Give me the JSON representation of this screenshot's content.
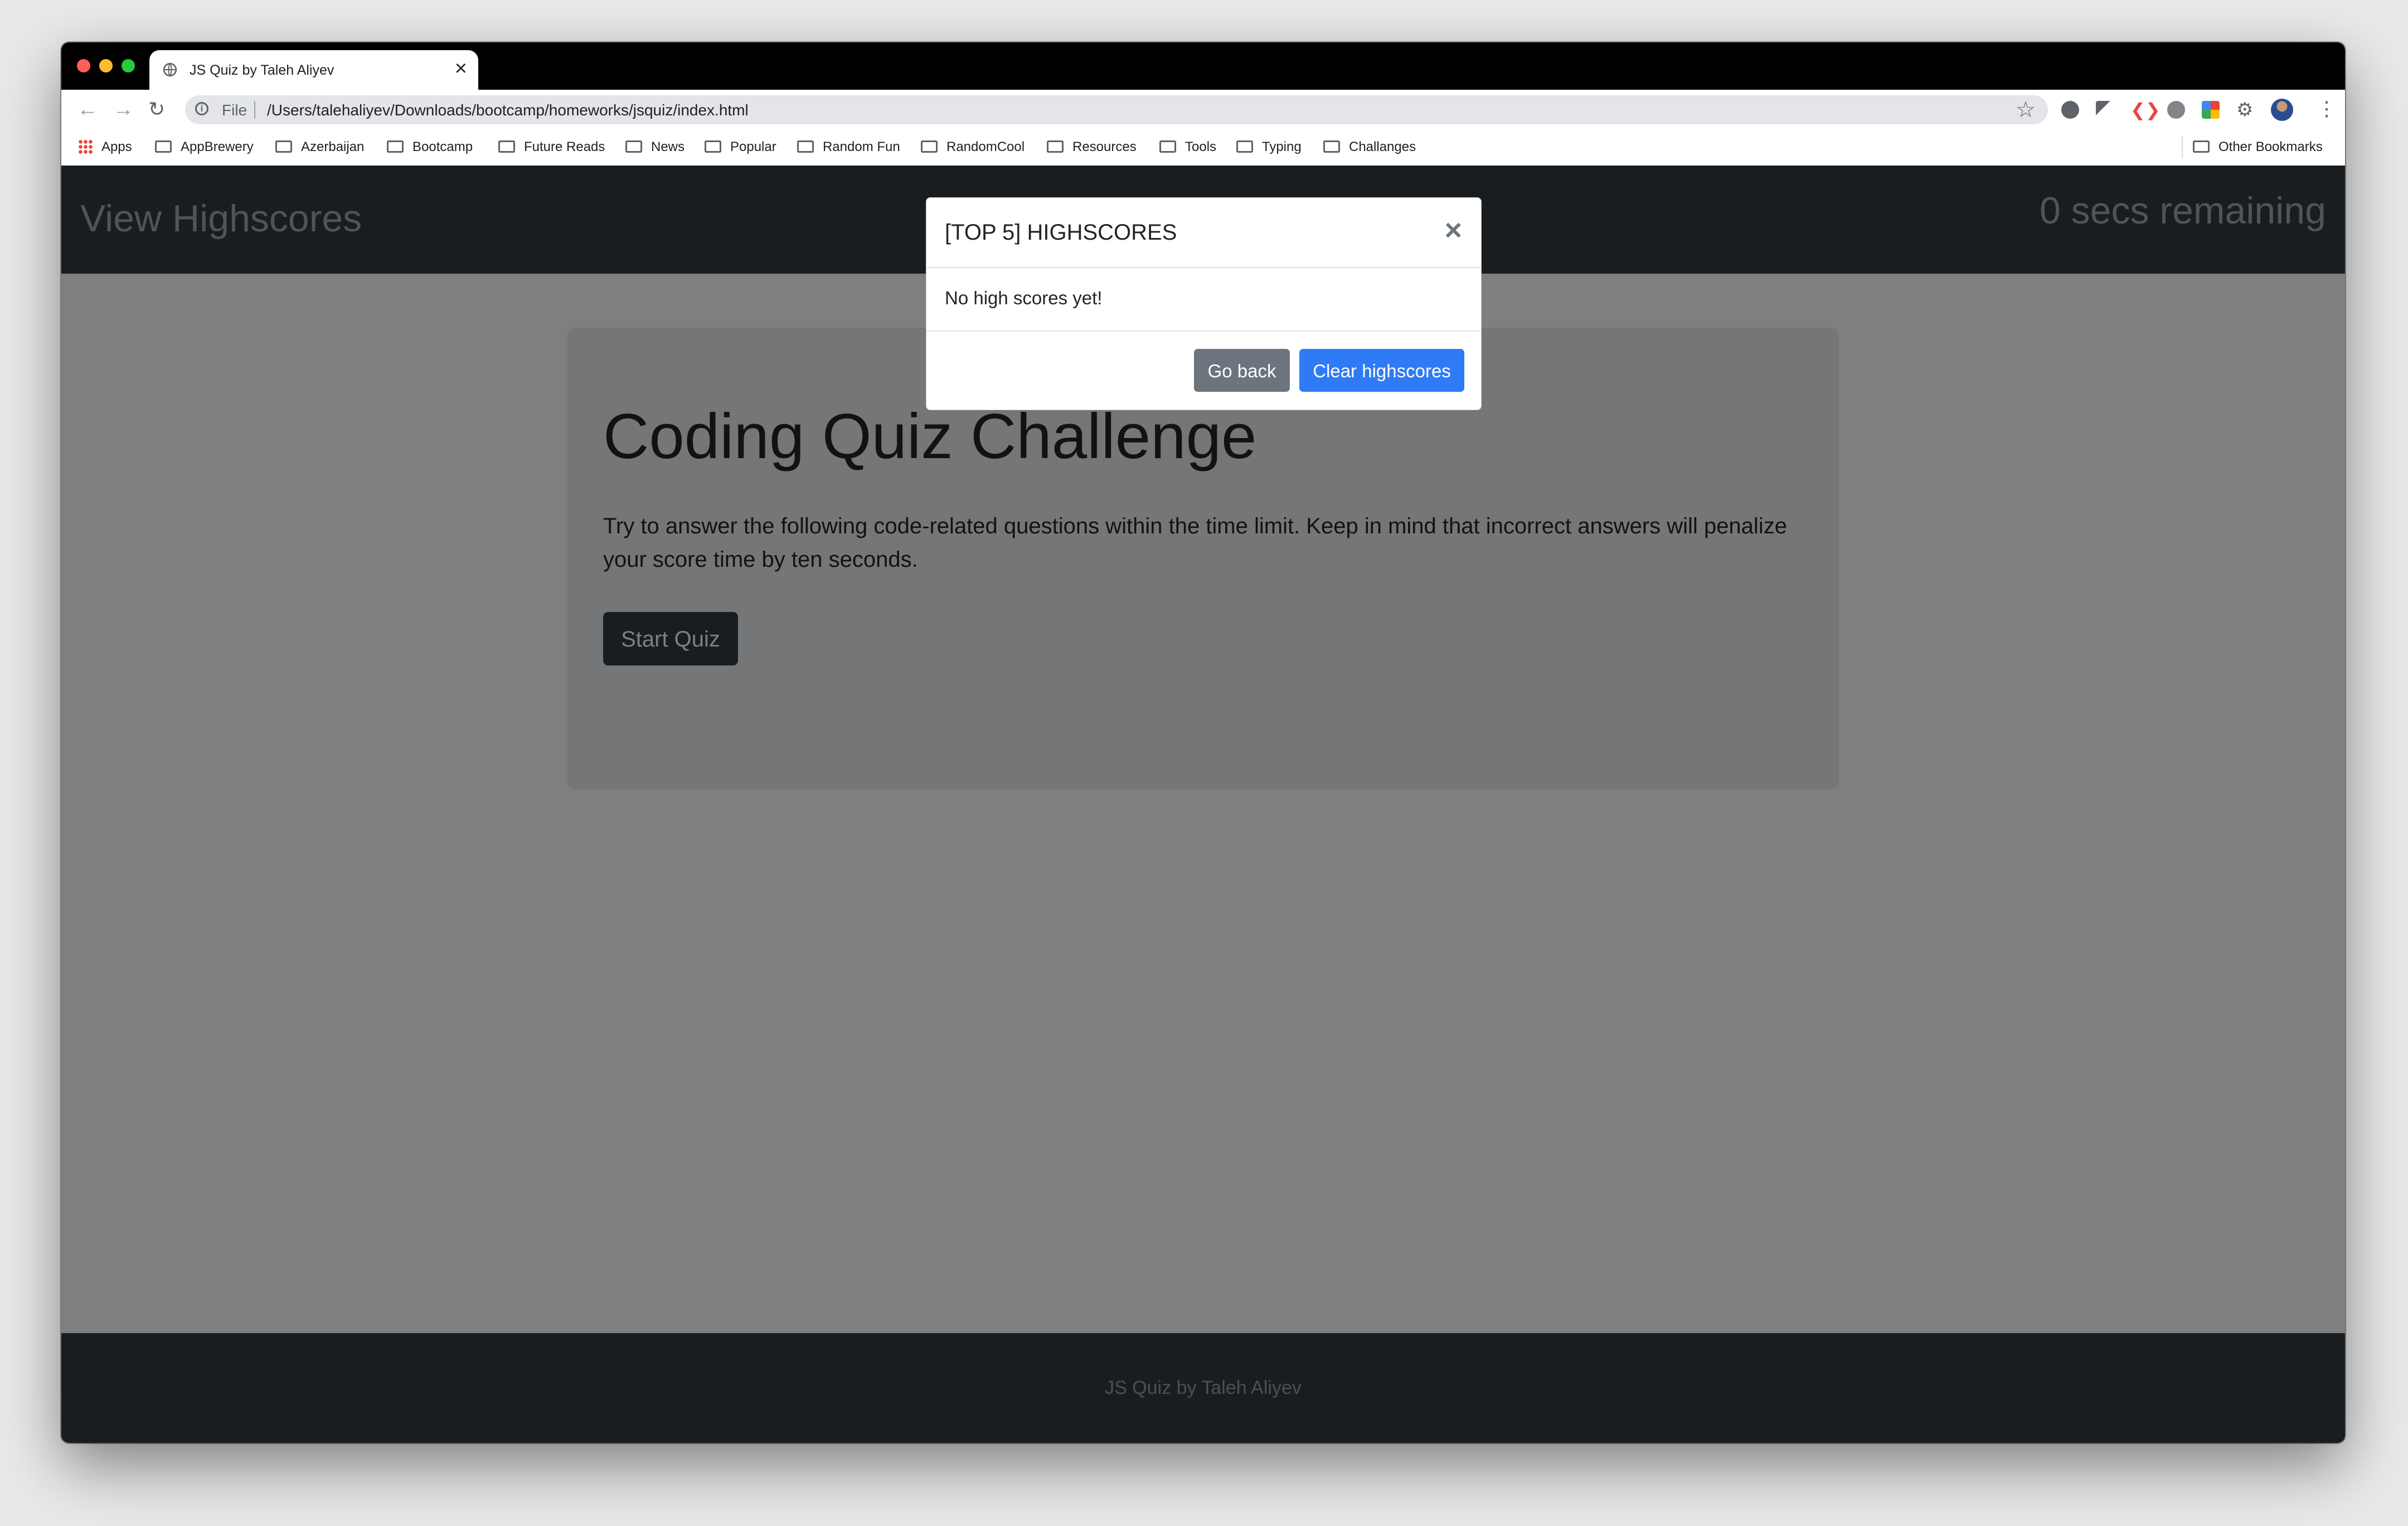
{
  "browser": {
    "tab_title": "JS Quiz by Taleh Aliyev",
    "tab_close": "×",
    "new_tab": "+",
    "url_scheme": "File",
    "url": "/Users/talehaliyev/Downloads/bootcamp/homeworks/jsquiz/index.html",
    "bookmarks": [
      "Apps",
      "AppBrewery",
      "Azerbaijan",
      "Bootcamp",
      "Future Reads",
      "News",
      "Popular",
      "Random Fun",
      "RandomCool",
      "Resources",
      "Tools",
      "Typing",
      "Challanges"
    ],
    "other_bookmarks": "Other Bookmarks"
  },
  "navbar": {
    "view_highscores": "View Highscores",
    "timer": "0 secs remaining"
  },
  "jumbotron": {
    "title": "Coding Quiz Challenge",
    "lead": "Try to answer the following code-related questions within the time limit. Keep in mind that incorrect answers will penalize your score time by ten seconds.",
    "start_button": "Start Quiz"
  },
  "modal": {
    "title": "[TOP 5] HIGHSCORES",
    "close": "×",
    "body": "No high scores yet!",
    "go_back": "Go back",
    "clear": "Clear highscores"
  },
  "footer": {
    "text": "JS Quiz by Taleh Aliyev"
  },
  "colors": {
    "navbar_bg": "#343a40",
    "primary": "#2f7bf5",
    "secondary": "#6c757d",
    "jumbotron_bg": "#e9ecef"
  }
}
